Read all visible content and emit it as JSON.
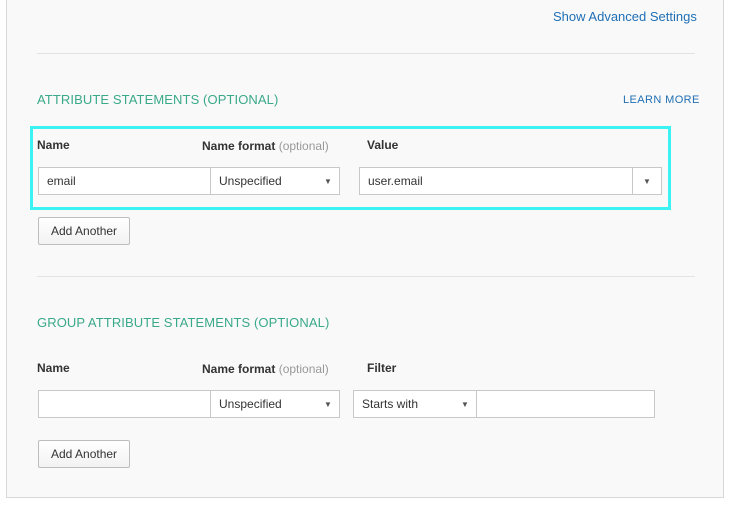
{
  "header": {
    "advanced_link": "Show Advanced Settings"
  },
  "attribute_section": {
    "title": "ATTRIBUTE STATEMENTS (OPTIONAL)",
    "learn_more": "LEARN MORE",
    "col_name": "Name",
    "col_name_format": "Name format",
    "col_name_format_opt": "(optional)",
    "col_value": "Value",
    "row": {
      "name_value": "email",
      "name_format": "Unspecified",
      "value": "user.email"
    },
    "add_button": "Add Another"
  },
  "group_section": {
    "title": "GROUP ATTRIBUTE STATEMENTS (OPTIONAL)",
    "col_name": "Name",
    "col_name_format": "Name format",
    "col_name_format_opt": "(optional)",
    "col_filter": "Filter",
    "row": {
      "name_value": "",
      "name_format": "Unspecified",
      "filter_type": "Starts with",
      "filter_value": ""
    },
    "add_button": "Add Another"
  },
  "colors": {
    "section_title": "#3aa98a",
    "link": "#1f6fb5",
    "highlight": "#3df2f2"
  }
}
